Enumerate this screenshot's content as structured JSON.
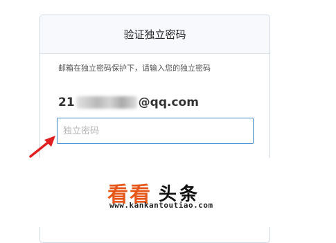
{
  "dialog": {
    "title": "验证独立密码",
    "description": "邮箱在独立密码保护下，请输入您的独立密码",
    "email_prefix": "21",
    "email_suffix": "@qq.com",
    "password_placeholder": "独立密码"
  },
  "colors": {
    "border": "#cfd8e3",
    "input_focus": "#3c8ad0",
    "annotation_arrow": "#e02020",
    "watermark_accent": "#e8571a"
  },
  "watermark": {
    "logo_orange": "看看",
    "logo_black": "头条",
    "url": "www.kankantoutiao.com"
  }
}
